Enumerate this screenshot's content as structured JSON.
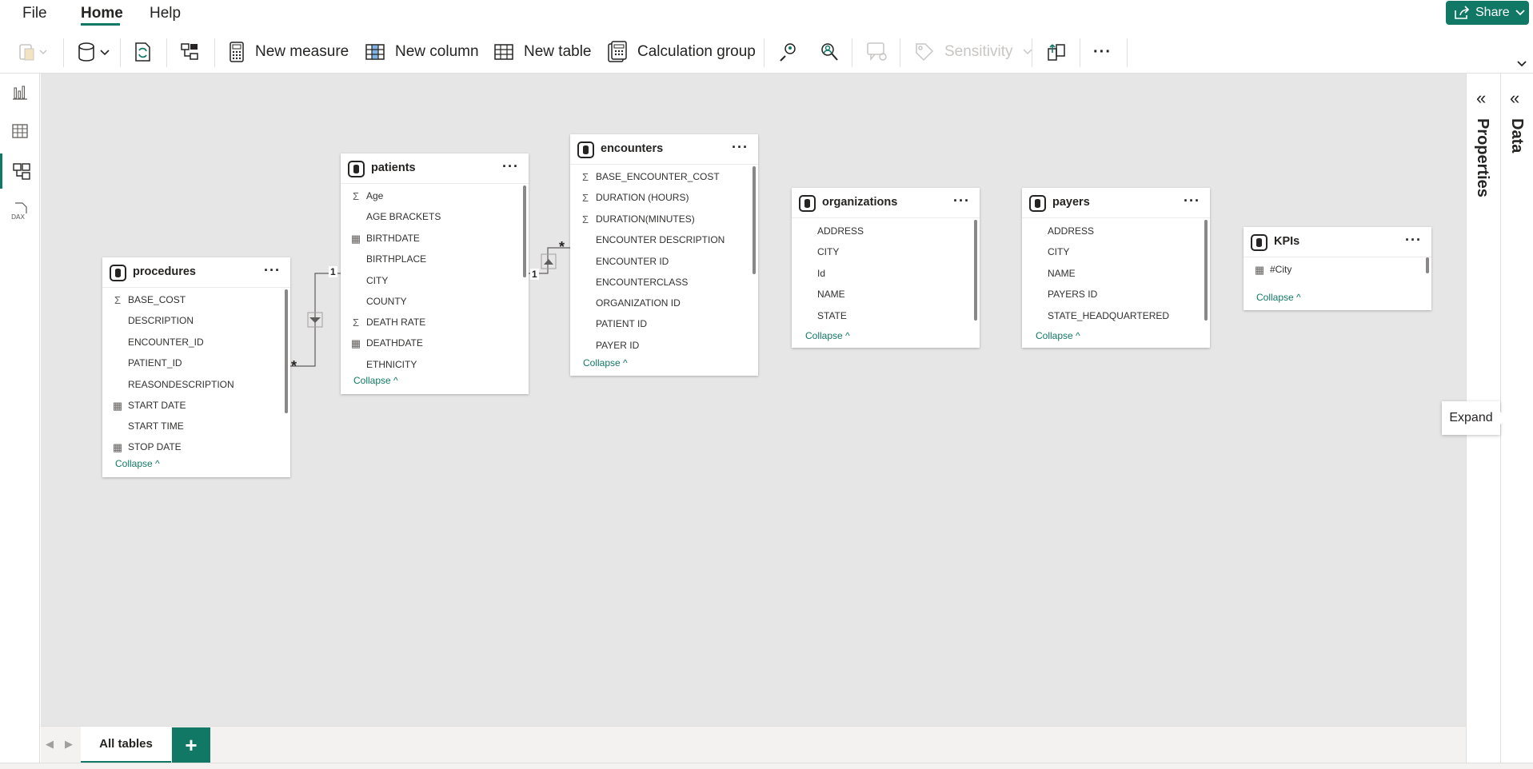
{
  "menu": {
    "file": "File",
    "home": "Home",
    "help": "Help",
    "share": "Share"
  },
  "ribbon": {
    "new_measure": "New measure",
    "new_column": "New column",
    "new_table": "New table",
    "calculation_group": "Calculation group",
    "sensitivity": "Sensitivity",
    "more": "···"
  },
  "tables": {
    "procedures": {
      "name": "procedures",
      "fields": [
        {
          "label": "BASE_COST",
          "icon": "sigma"
        },
        {
          "label": "DESCRIPTION",
          "icon": ""
        },
        {
          "label": "ENCOUNTER_ID",
          "icon": ""
        },
        {
          "label": "PATIENT_ID",
          "icon": ""
        },
        {
          "label": "REASONDESCRIPTION",
          "icon": ""
        },
        {
          "label": "START DATE",
          "icon": "calendar"
        },
        {
          "label": "START TIME",
          "icon": ""
        },
        {
          "label": "STOP DATE",
          "icon": "calendar"
        }
      ],
      "collapse": "Collapse"
    },
    "patients": {
      "name": "patients",
      "fields": [
        {
          "label": "Age",
          "icon": "sigma"
        },
        {
          "label": "AGE BRACKETS",
          "icon": ""
        },
        {
          "label": "BIRTHDATE",
          "icon": "calendar"
        },
        {
          "label": "BIRTHPLACE",
          "icon": ""
        },
        {
          "label": "CITY",
          "icon": ""
        },
        {
          "label": "COUNTY",
          "icon": ""
        },
        {
          "label": "DEATH RATE",
          "icon": "sigma"
        },
        {
          "label": "DEATHDATE",
          "icon": "calendar"
        },
        {
          "label": "ETHNICITY",
          "icon": ""
        }
      ],
      "collapse": "Collapse"
    },
    "encounters": {
      "name": "encounters",
      "fields": [
        {
          "label": "BASE_ENCOUNTER_COST",
          "icon": "sigma"
        },
        {
          "label": "DURATION (HOURS)",
          "icon": "sigma"
        },
        {
          "label": "DURATION(MINUTES)",
          "icon": "sigma"
        },
        {
          "label": "ENCOUNTER DESCRIPTION",
          "icon": ""
        },
        {
          "label": "ENCOUNTER ID",
          "icon": ""
        },
        {
          "label": "ENCOUNTERCLASS",
          "icon": ""
        },
        {
          "label": "ORGANIZATION ID",
          "icon": ""
        },
        {
          "label": "PATIENT ID",
          "icon": ""
        },
        {
          "label": "PAYER ID",
          "icon": ""
        }
      ],
      "collapse": "Collapse"
    },
    "organizations": {
      "name": "organizations",
      "fields": [
        {
          "label": "ADDRESS",
          "icon": ""
        },
        {
          "label": "CITY",
          "icon": ""
        },
        {
          "label": "Id",
          "icon": ""
        },
        {
          "label": "NAME",
          "icon": ""
        },
        {
          "label": "STATE",
          "icon": ""
        }
      ],
      "collapse": "Collapse"
    },
    "payers": {
      "name": "payers",
      "fields": [
        {
          "label": "ADDRESS",
          "icon": ""
        },
        {
          "label": "CITY",
          "icon": ""
        },
        {
          "label": "NAME",
          "icon": ""
        },
        {
          "label": "PAYERS ID",
          "icon": ""
        },
        {
          "label": "STATE_HEADQUARTERED",
          "icon": ""
        }
      ],
      "collapse": "Collapse"
    },
    "kpis": {
      "name": "KPIs",
      "fields": [
        {
          "label": "#City",
          "icon": "calculator"
        }
      ],
      "collapse": "Collapse"
    }
  },
  "relationships": {
    "one": "1",
    "many": "*"
  },
  "panes": {
    "properties": "Properties",
    "data": "Data"
  },
  "tooltip": "Expand",
  "tabs": {
    "all_tables": "All tables",
    "add": "+"
  },
  "colors": {
    "accent": "#117865",
    "canvas": "#e6e6e6"
  }
}
